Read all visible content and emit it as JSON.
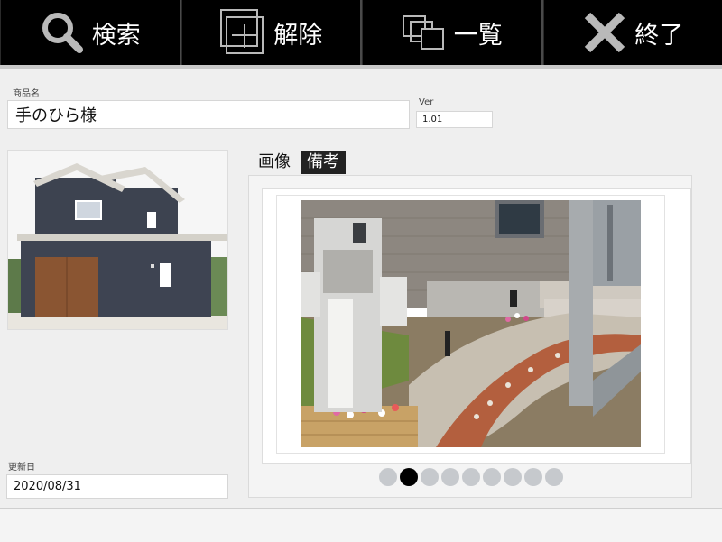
{
  "toolbar": {
    "search_label": "検索",
    "clear_label": "解除",
    "list_label": "一覧",
    "exit_label": "終了"
  },
  "product": {
    "name_label": "商品名",
    "name_value": "手のひら様",
    "ver_label": "Ver",
    "ver_value": "1.01",
    "updated_label": "更新日",
    "updated_value": "2020/08/31"
  },
  "tabs": {
    "image_label": "画像",
    "notes_label": "備考",
    "active": "image"
  },
  "carousel": {
    "total": 9,
    "active_index": 1
  },
  "icons": [
    "search-icon",
    "add-frame-icon",
    "list-icon",
    "close-icon"
  ],
  "colors": {
    "toolbar_bg": "#000000",
    "dot_active": "#000000",
    "dot_inactive": "#c6c9cd"
  }
}
